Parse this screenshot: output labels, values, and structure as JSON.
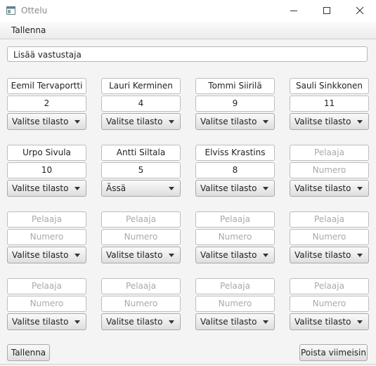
{
  "window": {
    "title": "Ottelu",
    "icon": "app-window-icon",
    "accent": "#f4f4f4"
  },
  "menu": {
    "save_label": "Tallenna"
  },
  "opponent_field": {
    "value": "Lisää vastustaja"
  },
  "players": [
    {
      "name": "Eemil Tervaportti",
      "number": "2",
      "stat": "Valitse tilasto"
    },
    {
      "name": "Lauri Kerminen",
      "number": "4",
      "stat": "Valitse tilasto"
    },
    {
      "name": "Tommi Siirilä",
      "number": "9",
      "stat": "Valitse tilasto"
    },
    {
      "name": "Sauli Sinkkonen",
      "number": "11",
      "stat": "Valitse tilasto"
    },
    {
      "name": "Urpo Sivula",
      "number": "10",
      "stat": "Valitse tilasto"
    },
    {
      "name": "Antti Siltala",
      "number": "5",
      "stat": "Ässä"
    },
    {
      "name": "Elviss Krastins",
      "number": "8",
      "stat": "Valitse tilasto"
    },
    {
      "name": "",
      "number": "",
      "stat": "Valitse tilasto"
    },
    {
      "name": "",
      "number": "",
      "stat": "Valitse tilasto"
    },
    {
      "name": "",
      "number": "",
      "stat": "Valitse tilasto"
    },
    {
      "name": "",
      "number": "",
      "stat": "Valitse tilasto"
    },
    {
      "name": "",
      "number": "",
      "stat": "Valitse tilasto"
    },
    {
      "name": "",
      "number": "",
      "stat": "Valitse tilasto"
    },
    {
      "name": "",
      "number": "",
      "stat": "Valitse tilasto"
    },
    {
      "name": "",
      "number": "",
      "stat": "Valitse tilasto"
    },
    {
      "name": "",
      "number": "",
      "stat": "Valitse tilasto"
    }
  ],
  "placeholders": {
    "name": "Pelaaja",
    "number": "Numero"
  },
  "buttons": {
    "save_label": "Tallenna",
    "remove_latest_label": "Poista viimeisin"
  }
}
